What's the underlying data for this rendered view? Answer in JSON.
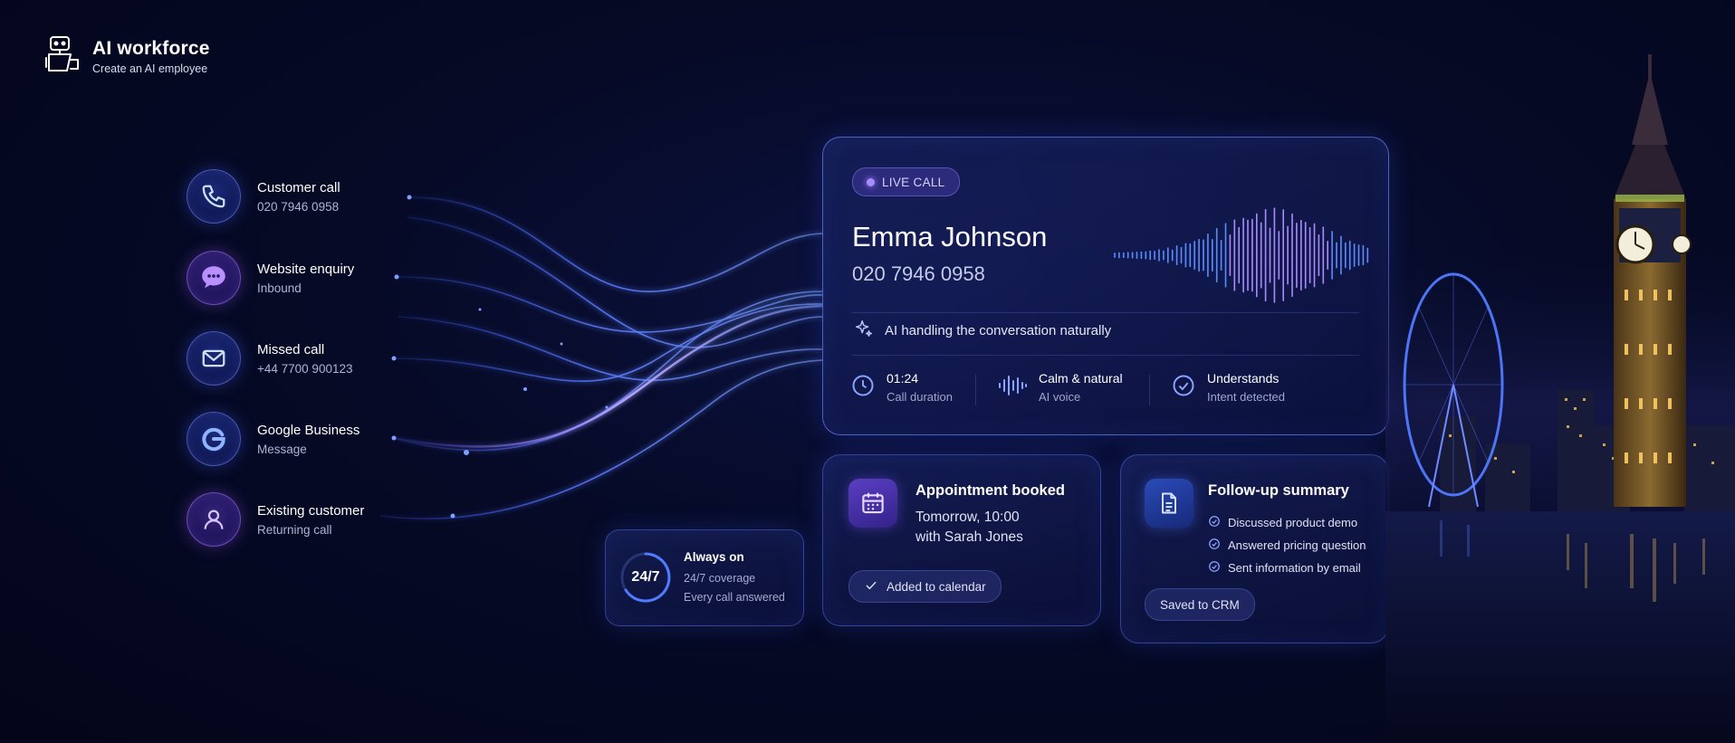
{
  "brand": {
    "title": "AI workforce",
    "subtitle": "Create an AI employee"
  },
  "channels": [
    {
      "title": "Customer call",
      "sub": "020 7946 0958",
      "icon": "phone-icon"
    },
    {
      "title": "Website enquiry",
      "sub": "Inbound",
      "icon": "chat-icon"
    },
    {
      "title": "Missed call",
      "sub": "+44 7700 900123",
      "icon": "mail-icon"
    },
    {
      "title": "Google Business",
      "sub": "Message",
      "icon": "google-icon"
    },
    {
      "title": "Existing customer",
      "sub": "Returning call",
      "icon": "user-icon"
    }
  ],
  "live_call": {
    "badge": "LIVE CALL",
    "name": "Emma Johnson",
    "phone": "020 7946 0958",
    "ai_note": "AI handling the conversation naturally",
    "stats": [
      {
        "title": "01:24",
        "sub": "Call duration",
        "icon": "clock-icon"
      },
      {
        "title": "Calm & natural",
        "sub": "AI voice",
        "icon": "voice-wave-icon"
      },
      {
        "title": "Understands",
        "sub": "Intent detected",
        "icon": "check-circle-icon"
      }
    ]
  },
  "always_on": {
    "ring_label": "24/7",
    "title": "Always on",
    "line1": "24/7 coverage",
    "line2": "Every call answered"
  },
  "appointment": {
    "title": "Appointment booked",
    "line1": "Tomorrow, 10:00",
    "line2": "with Sarah Jones",
    "pill": "Added to calendar"
  },
  "followup": {
    "title": "Follow-up summary",
    "items": [
      "Discussed product demo",
      "Answered pricing question",
      "Sent information by email"
    ],
    "pill": "Saved to CRM"
  },
  "colors": {
    "background": "#050926",
    "accent_blue": "#4d6bff",
    "accent_purple": "#a98bff",
    "card_border": "#5f78ff"
  }
}
